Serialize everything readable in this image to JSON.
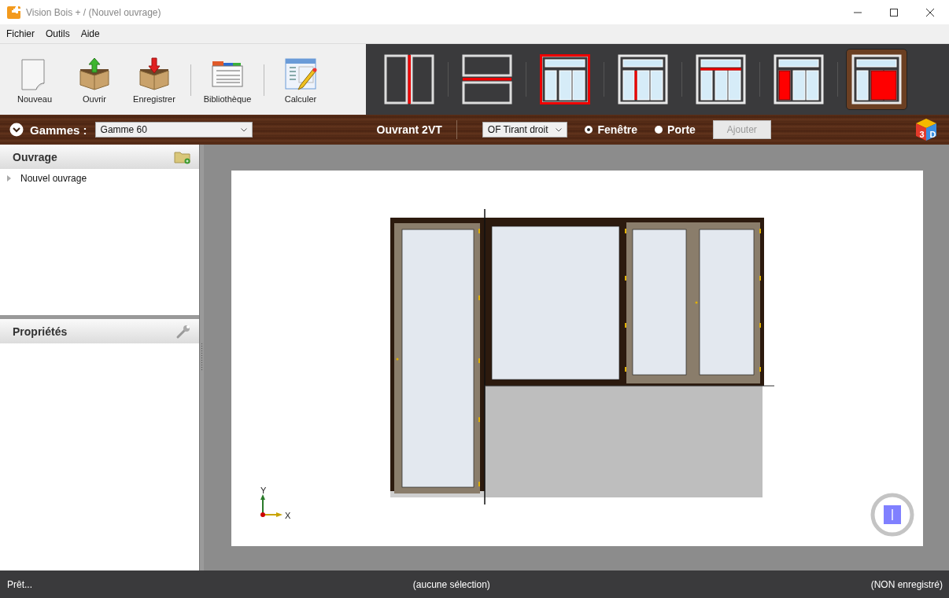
{
  "window": {
    "title": "Vision Bois + / (Nouvel ouvrage)"
  },
  "menu": [
    {
      "label": "Fichier"
    },
    {
      "label": "Outils"
    },
    {
      "label": "Aide"
    }
  ],
  "toolbar": [
    {
      "label": "Nouveau",
      "kind": "new"
    },
    {
      "label": "Ouvrir",
      "kind": "open"
    },
    {
      "label": "Enregistrer",
      "kind": "save"
    },
    {
      "label": "Bibliothèque",
      "kind": "library"
    },
    {
      "label": "Calculer",
      "kind": "calculate"
    }
  ],
  "templates": [
    {
      "kind": "mullion",
      "selected": false
    },
    {
      "kind": "transom",
      "selected": false
    },
    {
      "kind": "frame",
      "selected": false
    },
    {
      "kind": "window-mullion",
      "selected": false
    },
    {
      "kind": "window-transom",
      "selected": false
    },
    {
      "kind": "window-side",
      "selected": false
    },
    {
      "kind": "window-double",
      "selected": true
    }
  ],
  "range_bar": {
    "label": "Gammes :",
    "range": "Gamme 60",
    "title": "Ouvrant 2VT",
    "opening": "OF Tirant droit",
    "types": [
      {
        "label": "Fenêtre",
        "selected": true
      },
      {
        "label": "Porte",
        "selected": false
      }
    ],
    "add_button": {
      "label": "Ajouter",
      "disabled": true
    },
    "view_3d": [
      "3",
      "D"
    ]
  },
  "ouvrage_panel": {
    "title": "Ouvrage",
    "tree": [
      {
        "label": "Nouvel ouvrage",
        "expanded": false
      }
    ]
  },
  "properties_panel": {
    "title": "Propriétés"
  },
  "canvas": {
    "axis_labels": [
      "Y",
      "X"
    ]
  },
  "status_bar": {
    "left": "Prêt...",
    "center": "(aucune sélection)",
    "right": "(NON enregistré)"
  }
}
